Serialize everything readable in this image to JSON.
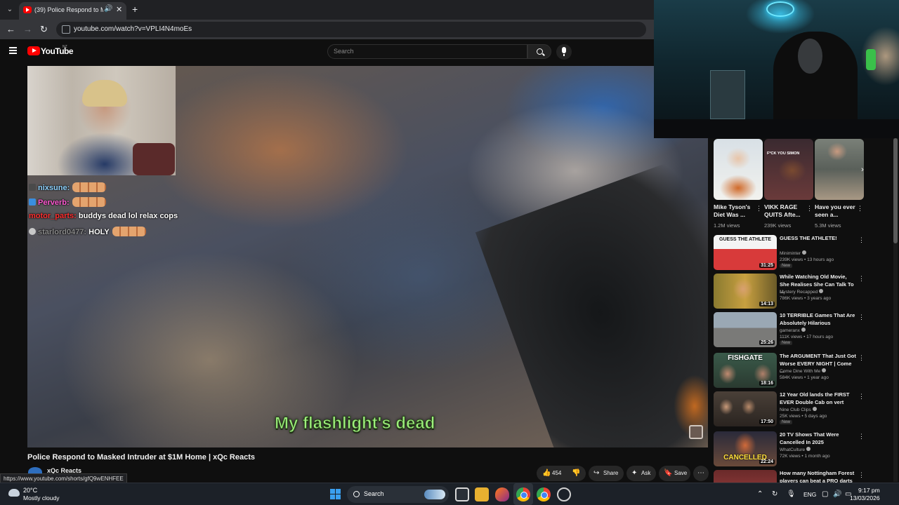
{
  "browser": {
    "tab_title": "(39) Police Respond to Masked",
    "url": "youtube.com/watch?v=VPLI4N4moEs",
    "status_url": "https://www.youtube.com/shorts/gfQ9wENHFEE"
  },
  "youtube": {
    "wordmark": "YouTube",
    "country": "NZ",
    "search_placeholder": "Search"
  },
  "video": {
    "title": "Police Respond to Masked Intruder at $1M Home | xQc Reacts",
    "channel": "xQc Reacts",
    "subtitle": "My flashlight's dead",
    "likes": "454",
    "share_label": "Share",
    "ask_label": "Ask",
    "save_label": "Save",
    "chat": [
      {
        "user": "nixsune:",
        "message": "",
        "user_color": "#8fd3ff"
      },
      {
        "user": "Perverb:",
        "message": "",
        "user_color": "#ff5ad2"
      },
      {
        "user": "motor_parts:",
        "message": "buddys dead lol relax cops",
        "user_color": "#ff3030"
      },
      {
        "user": "starlord0477:",
        "message": "HOLY",
        "user_color": "#8a8a8a"
      }
    ]
  },
  "shorts": [
    {
      "title": "Mike Tyson's Diet Was ...",
      "views": "1.2M views"
    },
    {
      "title": "VIKK RAGE QUITS Afte...",
      "views": "239K views",
      "thumb_text": "F*CK YOU SIMON"
    },
    {
      "title": "Have you ever seen a...",
      "views": "5.3M views"
    }
  ],
  "recommendations": [
    {
      "title": "GUESS THE ATHLETE!",
      "channel": "Miniminter",
      "meta": "239K views • 13 hours ago",
      "duration": "31:25",
      "badge": "New",
      "thumb_text": "GUESS THE ATHLETE"
    },
    {
      "title": "While Watching Old Movie, She Realises She Can Talk To ...",
      "channel": "Mystery Recapped",
      "meta": "786K views • 3 years ago",
      "duration": "14:13",
      "badge": ""
    },
    {
      "title": "10 TERRIBLE Games That Are Absolutely Hilarious",
      "channel": "gameranx",
      "meta": "111K views • 17 hours ago",
      "duration": "25:26",
      "badge": "New"
    },
    {
      "title": "The ARGUMENT That Just Got Worse EVERY NIGHT | Come ...",
      "channel": "Come Dine With Me",
      "meta": "584K views • 1 year ago",
      "duration": "18:16",
      "badge": "",
      "thumb_text": "FISHGATE"
    },
    {
      "title": "12 Year Old lands the FIRST EVER Double Cab on vert",
      "channel": "Nine Club Clips",
      "meta": "25K views • 5 days ago",
      "duration": "17:50",
      "badge": "New"
    },
    {
      "title": "20 TV Shows That Were Cancelled In 2025",
      "channel": "WhatCulture",
      "meta": "72K views • 1 month ago",
      "duration": "22:24",
      "badge": "",
      "thumb_text": "CANCELLED"
    },
    {
      "title": "How many Nottingham Forest players can beat a PRO darts ...",
      "channel": "",
      "meta": "",
      "duration": "",
      "badge": ""
    }
  ],
  "taskbar": {
    "temperature": "20°C",
    "weather": "Mostly cloudy",
    "search_label": "Search",
    "language": "ENG",
    "time": "9:17 pm",
    "date": "13/03/2026"
  },
  "colors": {
    "youtube_red": "#ff0000",
    "subtitle_green": "#9ef07d",
    "background": "#0f0f0f"
  }
}
